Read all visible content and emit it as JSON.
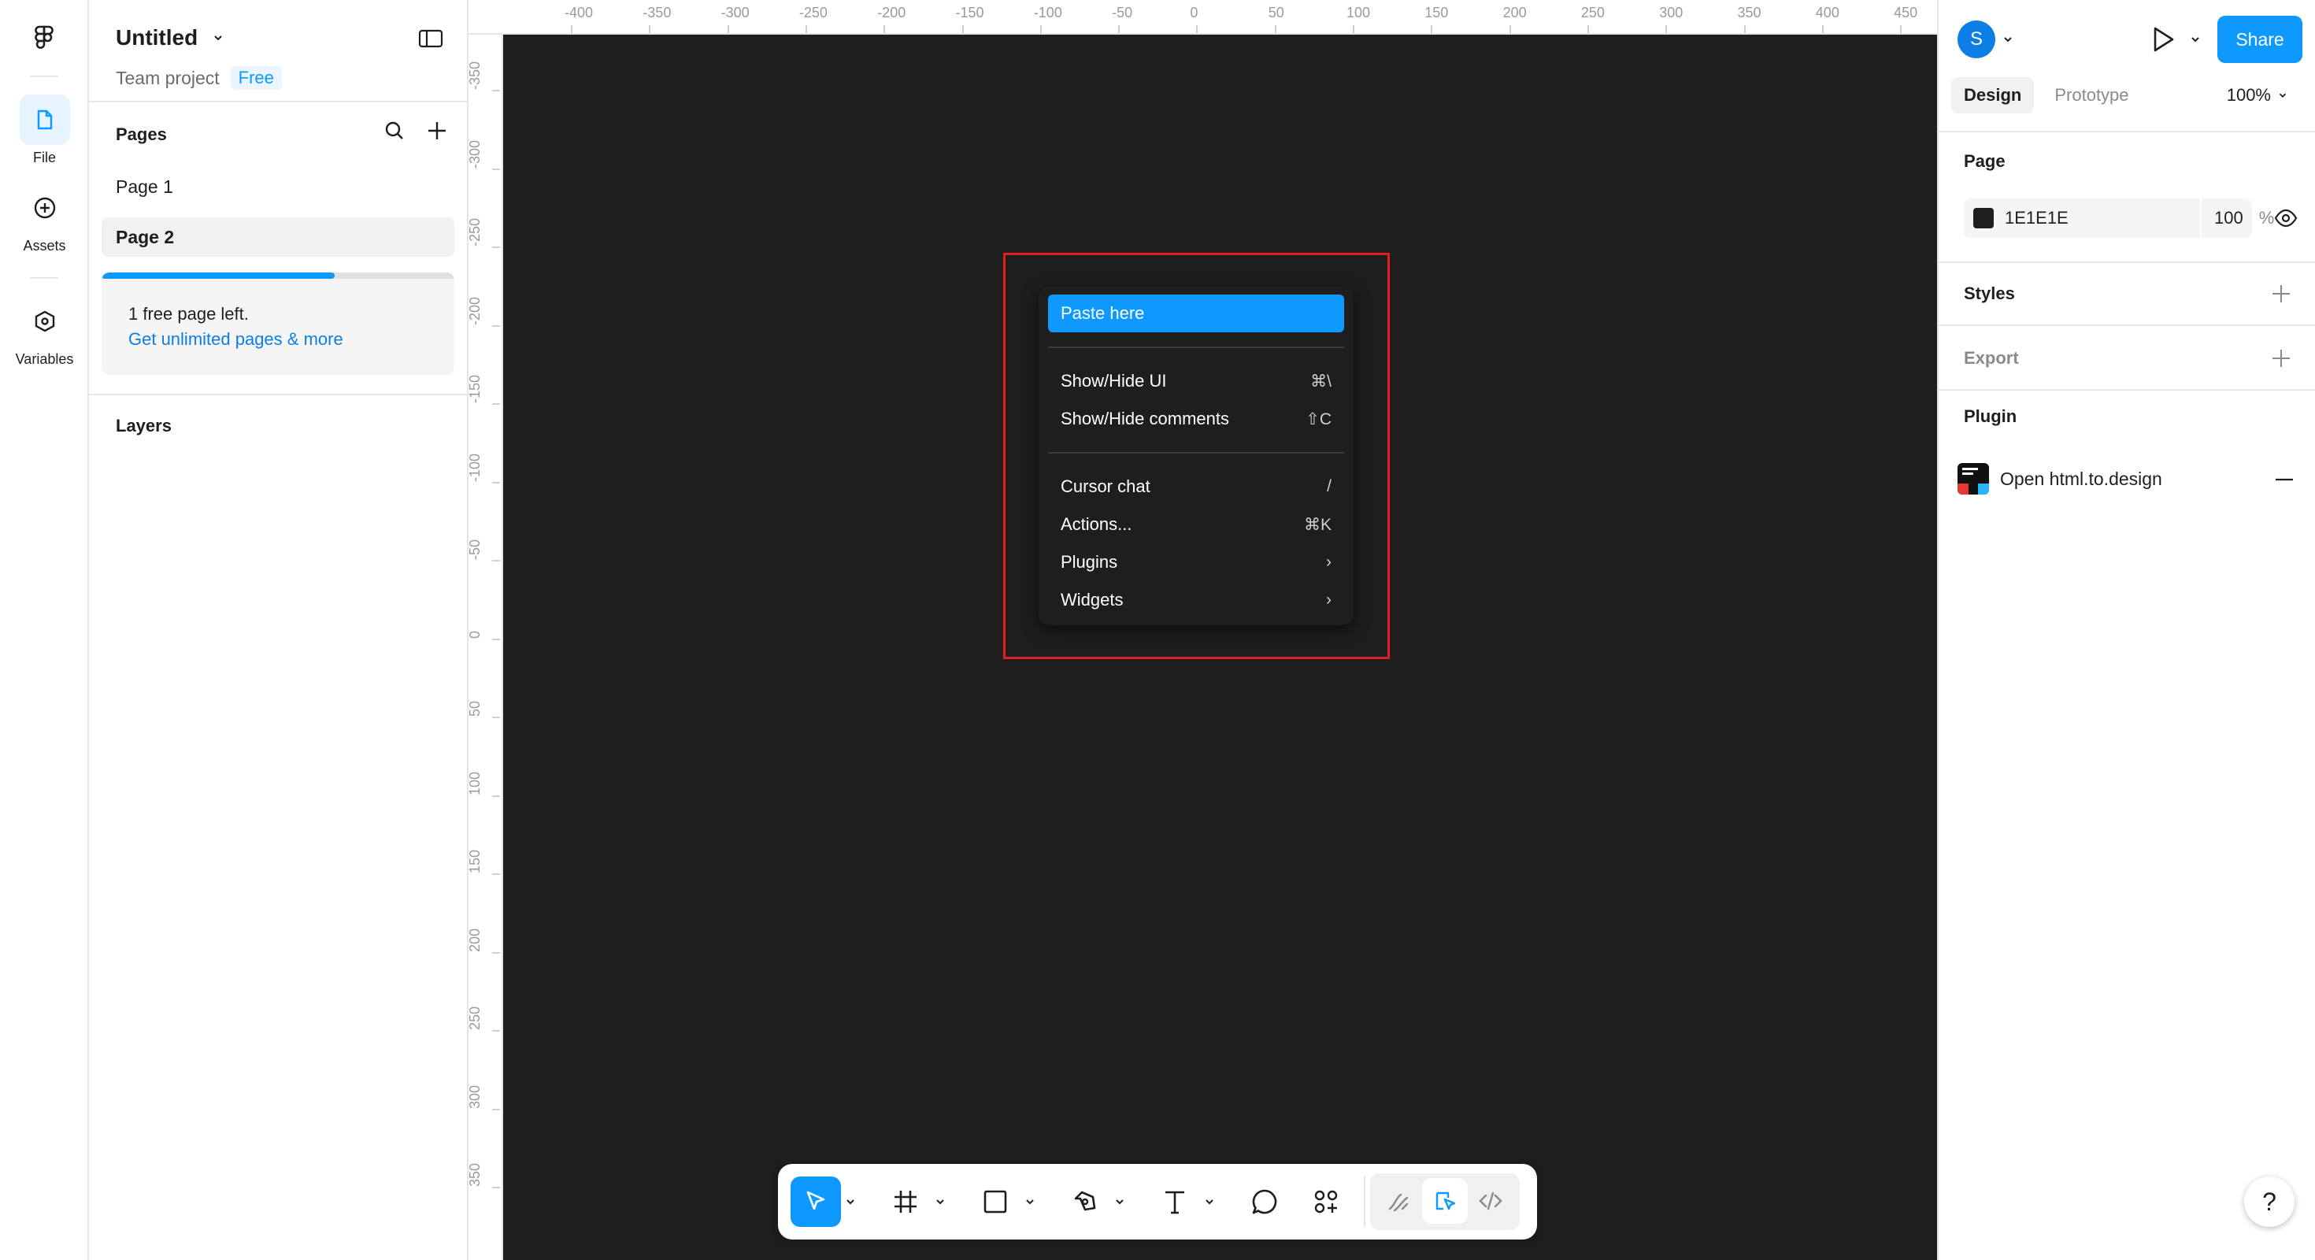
{
  "rail": {
    "items": [
      {
        "label": "File",
        "icon": "file-icon",
        "active": true
      },
      {
        "label": "Assets",
        "icon": "assets-icon",
        "active": false
      },
      {
        "label": "Variables",
        "icon": "variables-icon",
        "active": false
      }
    ]
  },
  "file": {
    "title": "Untitled",
    "project": "Team project",
    "plan": "Free"
  },
  "pages": {
    "heading": "Pages",
    "items": [
      {
        "label": "Page 1",
        "selected": false
      },
      {
        "label": "Page 2",
        "selected": true
      }
    ],
    "upsell": {
      "text": "1 free page left.",
      "link": "Get unlimited pages & more",
      "progress": 0.66
    }
  },
  "layers": {
    "heading": "Layers"
  },
  "rulers": {
    "top": [
      "-400",
      "-350",
      "-300",
      "-250",
      "-200",
      "-150",
      "-100",
      "-50",
      "0",
      "50",
      "100",
      "150",
      "200",
      "250",
      "300",
      "350",
      "400",
      "450"
    ],
    "left": [
      "-350",
      "-300",
      "-250",
      "-200",
      "-150",
      "-100",
      "-50",
      "0",
      "50",
      "100",
      "150",
      "200",
      "250",
      "300",
      "350"
    ]
  },
  "context_menu": {
    "groups": [
      [
        {
          "label": "Paste here",
          "shortcut": "",
          "highlighted": true
        }
      ],
      [
        {
          "label": "Show/Hide UI",
          "shortcut": "⌘\\"
        },
        {
          "label": "Show/Hide comments",
          "shortcut": "⇧C"
        }
      ],
      [
        {
          "label": "Cursor chat",
          "shortcut": "/"
        },
        {
          "label": "Actions...",
          "shortcut": "⌘K"
        },
        {
          "label": "Plugins",
          "shortcut": "›"
        },
        {
          "label": "Widgets",
          "shortcut": "›"
        }
      ]
    ]
  },
  "toolbar": {
    "tools": [
      "move-tool",
      "frame-tool",
      "shape-tool",
      "pen-tool",
      "text-tool",
      "comment-tool",
      "actions-tool"
    ],
    "modes": [
      "draw-mode",
      "design-mode",
      "dev-mode"
    ]
  },
  "right_panel": {
    "avatar_initial": "S",
    "share_label": "Share",
    "tabs": [
      {
        "label": "Design",
        "active": true
      },
      {
        "label": "Prototype",
        "active": false
      }
    ],
    "zoom": "100%",
    "page_section": "Page",
    "page_color": "1E1E1E",
    "page_opacity": "100",
    "opacity_unit": "%",
    "styles_section": "Styles",
    "export_section": "Export",
    "plugin_section": "Plugin",
    "plugin_name": "Open html.to.design",
    "help_label": "?"
  },
  "colors": {
    "accent": "#0d99ff",
    "canvas": "#1e1e1e",
    "highlight_outline": "#e11d1d"
  }
}
